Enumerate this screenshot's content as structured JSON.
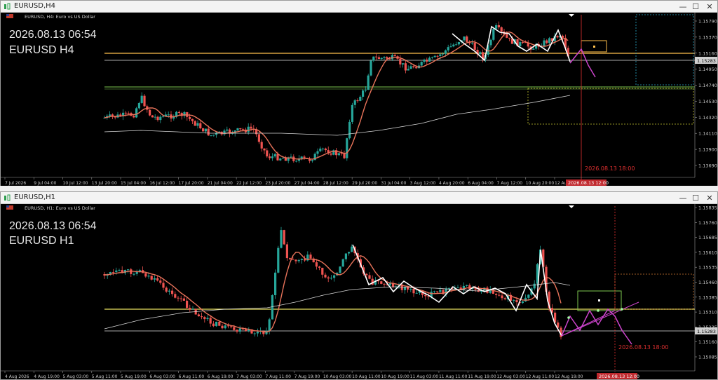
{
  "window1": {
    "title": "EURUSD,H4",
    "info": "EURUSD, H4:  Euro vs US Dollar",
    "datetime": "2026.08.13 06:54",
    "symbol": "EURUSD H4",
    "price_ticks": [
      "1.15790",
      "1.15370",
      "1.15160",
      "1.14950",
      "1.14740",
      "1.14530",
      "1.14320",
      "1.14110",
      "1.13900",
      "1.13690"
    ],
    "time_ticks": [
      "7 Jul 2026",
      "9 Jul 04:00",
      "10 Jul 12:00",
      "13 Jul 20:00",
      "15 Jul 04:00",
      "16 Jul 12:00",
      "17 Jul 20:00",
      "21 Jul 04:00",
      "22 Jul 12:00",
      "23 Jul 20:00",
      "27 Jul 04:00",
      "28 Jul 12:00",
      "29 Jul 20:00",
      "31 Jul 04:00",
      "3 Aug 12:00",
      "4 Aug 20:00",
      "6 Aug 04:00",
      "7 Aug 12:00",
      "10 Aug 20:00",
      "12 Aug"
    ],
    "current_price": "1.15283",
    "vline_label": "2026.08.13 18:00",
    "time_marker": "2026.08.13 12:00"
  },
  "window2": {
    "title": "EURUSD,H1",
    "info": "EURUSD, H1:  Euro vs US Dollar",
    "datetime": "2026.08.13 06:54",
    "symbol": "EURUSD H1",
    "price_ticks": [
      "1.15835",
      "1.15760",
      "1.15685",
      "1.15610",
      "1.15535",
      "1.15460",
      "1.15385",
      "1.15310",
      "1.15235",
      "1.15160",
      "1.15085"
    ],
    "time_ticks": [
      "4 Aug 2026",
      "4 Aug 19:00",
      "5 Aug 03:00",
      "5 Aug 11:00",
      "5 Aug 19:00",
      "6 Aug 03:00",
      "6 Aug 11:00",
      "6 Aug 19:00",
      "7 Aug 03:00",
      "7 Aug 11:00",
      "7 Aug 19:00",
      "10 Aug 03:00",
      "10 Aug 11:00",
      "10 Aug 19:00",
      "11 Aug 03:00",
      "11 Aug 11:00",
      "11 Aug 19:00",
      "12 Aug 03:00",
      "12 Aug 11:00",
      "12 Aug 19:00"
    ],
    "current_price": "1.15283",
    "vline_label": "2026.08.13 18:00",
    "time_marker": "2026.08.13 12:00"
  },
  "colors": {
    "bull": "#26a69a",
    "bear": "#ef5350",
    "ma_fast": "#e8735a",
    "ma_slow": "#d8d8d8",
    "level": "#ffc04d",
    "zigzag": "#ffffff",
    "forecast": "#cc44cc",
    "box": "#7ec850"
  },
  "icons": [
    "chart-window-icon",
    "minimize-icon",
    "maximize-icon",
    "close-icon"
  ]
}
